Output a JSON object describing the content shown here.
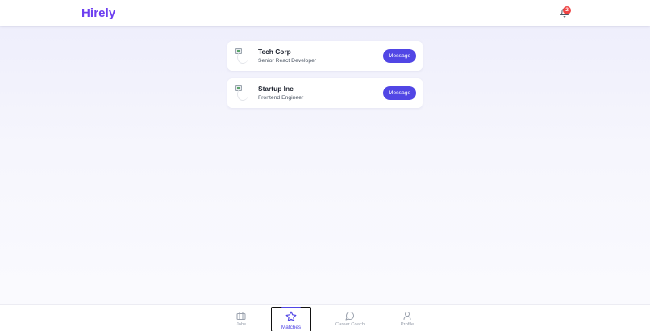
{
  "app": {
    "brand": "Hirely",
    "notification_count": "2"
  },
  "matches": [
    {
      "company": "Tech Corp",
      "role": "Senior React Developer",
      "action": "Message"
    },
    {
      "company": "Startup Inc",
      "role": "Frontend Engineer",
      "action": "Message"
    }
  ],
  "nav": {
    "items": [
      {
        "label": "Jobs",
        "icon": "briefcase-icon"
      },
      {
        "label": "Matches",
        "icon": "star-icon",
        "active": true
      },
      {
        "label": "Career Coach",
        "icon": "chat-bubble-icon"
      },
      {
        "label": "Profile",
        "icon": "user-icon"
      }
    ]
  },
  "colors": {
    "brand": "#6d3ff0",
    "accent": "#5146e5",
    "badge": "#ef4444"
  }
}
